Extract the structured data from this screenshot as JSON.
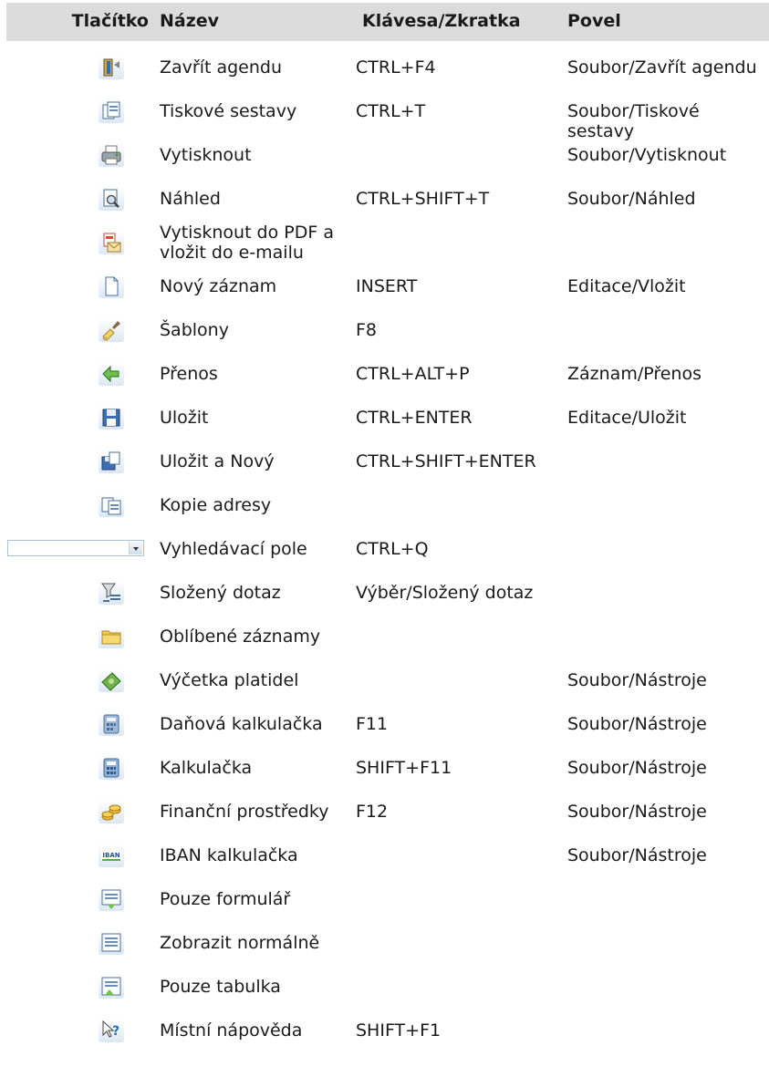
{
  "header": {
    "button": "Tlačítko",
    "name": "Název",
    "key": "Klávesa/Zkratka",
    "command": "Povel"
  },
  "rows": [
    {
      "icon": "close-agenda-icon",
      "name": "Zavřít agendu",
      "key": "CTRL+F4",
      "command": "Soubor/Zavřít agendu"
    },
    {
      "icon": "print-reports-icon",
      "name": "Tiskové sestavy",
      "key": "CTRL+T",
      "command": "Soubor/Tiskové sestavy"
    },
    {
      "icon": "printer-icon",
      "name": "Vytisknout",
      "key": "",
      "command": "Soubor/Vytisknout"
    },
    {
      "icon": "print-preview-icon",
      "name": "Náhled",
      "key": "CTRL+SHIFT+T",
      "command": "Soubor/Náhled"
    },
    {
      "icon": "pdf-email-icon",
      "name": "Vytisknout do PDF a vložit do e-mailu",
      "key": "",
      "command": ""
    },
    {
      "icon": "new-record-icon",
      "name": "Nový záznam",
      "key": "INSERT",
      "command": "Editace/Vložit"
    },
    {
      "icon": "templates-brush-icon",
      "name": "Šablony",
      "key": "F8",
      "command": ""
    },
    {
      "icon": "transfer-arrow-icon",
      "name": "Přenos",
      "key": "CTRL+ALT+P",
      "command": "Záznam/Přenos"
    },
    {
      "icon": "save-icon",
      "name": "Uložit",
      "key": "CTRL+ENTER",
      "command": "Editace/Uložit"
    },
    {
      "icon": "save-new-icon",
      "name": "Uložit a Nový",
      "key": "CTRL+SHIFT+ENTER",
      "command": ""
    },
    {
      "icon": "copy-address-icon",
      "name": "Kopie adresy",
      "key": "",
      "command": ""
    },
    {
      "icon": "search-combo",
      "name": "Vyhledávací pole",
      "key": "CTRL+Q",
      "command": ""
    },
    {
      "icon": "filter-query-icon",
      "name": "Složený dotaz",
      "key": "Výběr/Složený dotaz",
      "command": ""
    },
    {
      "icon": "folder-icon",
      "name": "Oblíbené záznamy",
      "key": "",
      "command": ""
    },
    {
      "icon": "money-icon",
      "name": "Výčetka platidel",
      "key": "",
      "command": "Soubor/Nástroje"
    },
    {
      "icon": "tax-calculator-icon",
      "name": "Daňová kalkulačka",
      "key": "F11",
      "command": "Soubor/Nástroje"
    },
    {
      "icon": "calculator-icon",
      "name": "Kalkulačka",
      "key": "SHIFT+F11",
      "command": "Soubor/Nástroje"
    },
    {
      "icon": "coins-icon",
      "name": "Finanční prostředky",
      "key": "F12",
      "command": "Soubor/Nástroje"
    },
    {
      "icon": "iban-icon",
      "name": "IBAN kalkulačka",
      "key": "",
      "command": "Soubor/Nástroje"
    },
    {
      "icon": "form-only-icon",
      "name": "Pouze formulář",
      "key": "",
      "command": ""
    },
    {
      "icon": "normal-view-icon",
      "name": "Zobrazit normálně",
      "key": "",
      "command": ""
    },
    {
      "icon": "table-only-icon",
      "name": "Pouze tabulka",
      "key": "",
      "command": ""
    },
    {
      "icon": "help-icon",
      "name": "Místní nápověda",
      "key": "SHIFT+F1",
      "command": ""
    }
  ],
  "icon_badge_text": {
    "iban": "IBAN"
  }
}
